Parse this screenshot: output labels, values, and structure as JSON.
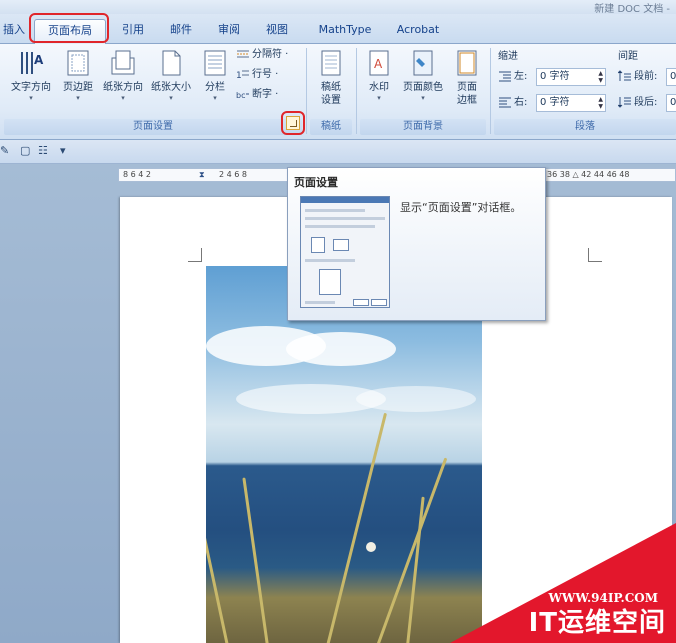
{
  "window": {
    "title": "新建 DOC 文档 -"
  },
  "tabs": [
    "插入",
    "页面布局",
    "引用",
    "邮件",
    "审阅",
    "视图",
    "MathType",
    "Acrobat"
  ],
  "ribbon": {
    "page_setup": {
      "group_label": "页面设置",
      "text_direction": "文字方向",
      "margins": "页边距",
      "orientation": "纸张方向",
      "size": "纸张大小",
      "columns": "分栏",
      "breaks": "分隔符 ·",
      "line_numbers": "行号 ·",
      "hyphenation": "断字 ·"
    },
    "draft_paper": {
      "group_label": "稿纸",
      "button": "稿纸",
      "button2": "设置"
    },
    "page_background": {
      "group_label": "页面背景",
      "watermark": "水印",
      "page_color": "页面颜色",
      "page_borders": "页面",
      "page_borders2": "边框"
    },
    "paragraph": {
      "group_label": "段落",
      "indent_label": "缩进",
      "indent_left_label": "左:",
      "indent_left_value": "0 字符",
      "indent_right_label": "右:",
      "indent_right_value": "0 字符",
      "spacing_label": "间距",
      "spacing_before_label": "段前:",
      "spacing_before_value": "0",
      "spacing_after_label": "段后:",
      "spacing_after_value": "0"
    }
  },
  "ruler": {
    "left_ticks": "8  6  4  2",
    "right_ticks": "2  4  6  8",
    "far_ticks": "36  38 △  42  44  46  48"
  },
  "tooltip": {
    "title": "页面设置",
    "description": "显示“页面设置”对话框。"
  },
  "watermark": {
    "url": "WWW.94IP.COM",
    "name": "IT运维空间",
    "color": "#e3172c"
  },
  "colors": {
    "highlight": "#e0262b",
    "ribbon_text": "#15428b"
  }
}
